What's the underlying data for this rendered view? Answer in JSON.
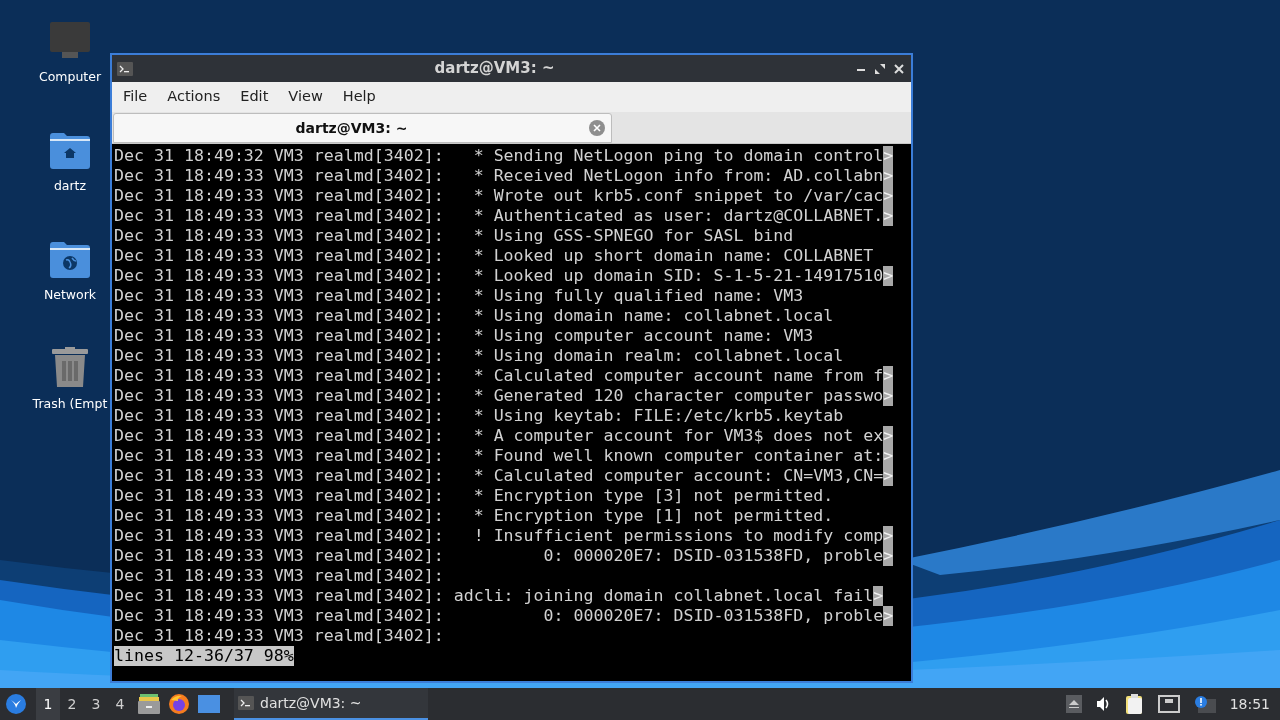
{
  "desktop_icons": [
    {
      "label": "Computer",
      "kind": "computer"
    },
    {
      "label": "dartz",
      "kind": "home"
    },
    {
      "label": "Network",
      "kind": "network"
    },
    {
      "label": "Trash (Empt",
      "kind": "trash"
    }
  ],
  "window": {
    "title": "dartz@VM3: ~",
    "menu": [
      "File",
      "Actions",
      "Edit",
      "View",
      "Help"
    ],
    "tabs": [
      {
        "label": "dartz@VM3: ~",
        "selected": true
      }
    ],
    "lines": [
      {
        "text": "Dec 31 18:49:32 VM3 realmd[3402]:   * Sending NetLogon ping to domain control",
        "more": ">"
      },
      {
        "text": "Dec 31 18:49:33 VM3 realmd[3402]:   * Received NetLogon info from: AD.collabn",
        "more": ">"
      },
      {
        "text": "Dec 31 18:49:33 VM3 realmd[3402]:   * Wrote out krb5.conf snippet to /var/cac",
        "more": ">"
      },
      {
        "text": "Dec 31 18:49:33 VM3 realmd[3402]:   * Authenticated as user: dartz@COLLABNET.",
        "more": ">"
      },
      {
        "text": "Dec 31 18:49:33 VM3 realmd[3402]:   * Using GSS-SPNEGO for SASL bind"
      },
      {
        "text": "Dec 31 18:49:33 VM3 realmd[3402]:   * Looked up short domain name: COLLABNET"
      },
      {
        "text": "Dec 31 18:49:33 VM3 realmd[3402]:   * Looked up domain SID: S-1-5-21-14917510",
        "more": ">"
      },
      {
        "text": "Dec 31 18:49:33 VM3 realmd[3402]:   * Using fully qualified name: VM3"
      },
      {
        "text": "Dec 31 18:49:33 VM3 realmd[3402]:   * Using domain name: collabnet.local"
      },
      {
        "text": "Dec 31 18:49:33 VM3 realmd[3402]:   * Using computer account name: VM3"
      },
      {
        "text": "Dec 31 18:49:33 VM3 realmd[3402]:   * Using domain realm: collabnet.local"
      },
      {
        "text": "Dec 31 18:49:33 VM3 realmd[3402]:   * Calculated computer account name from f",
        "more": ">"
      },
      {
        "text": "Dec 31 18:49:33 VM3 realmd[3402]:   * Generated 120 character computer passwo",
        "more": ">"
      },
      {
        "text": "Dec 31 18:49:33 VM3 realmd[3402]:   * Using keytab: FILE:/etc/krb5.keytab"
      },
      {
        "text": "Dec 31 18:49:33 VM3 realmd[3402]:   * A computer account for VM3$ does not ex",
        "more": ">"
      },
      {
        "text": "Dec 31 18:49:33 VM3 realmd[3402]:   * Found well known computer container at:",
        "more": ">"
      },
      {
        "text": "Dec 31 18:49:33 VM3 realmd[3402]:   * Calculated computer account: CN=VM3,CN=",
        "more": ">"
      },
      {
        "text": "Dec 31 18:49:33 VM3 realmd[3402]:   * Encryption type [3] not permitted."
      },
      {
        "text": "Dec 31 18:49:33 VM3 realmd[3402]:   * Encryption type [1] not permitted."
      },
      {
        "text": "Dec 31 18:49:33 VM3 realmd[3402]:   ! Insufficient permissions to modify comp",
        "more": ">"
      },
      {
        "text": "Dec 31 18:49:33 VM3 realmd[3402]:          0: 000020E7: DSID-031538FD, proble",
        "more": ">"
      },
      {
        "text": "Dec 31 18:49:33 VM3 realmd[3402]:"
      },
      {
        "text": "Dec 31 18:49:33 VM3 realmd[3402]: adcli: joining domain collabnet.local fail",
        "more": ">"
      },
      {
        "text": "Dec 31 18:49:33 VM3 realmd[3402]:          0: 000020E7: DSID-031538FD, proble",
        "more": ">"
      },
      {
        "text": "Dec 31 18:49:33 VM3 realmd[3402]:"
      }
    ],
    "pager_status": "lines 12-36/37 98%"
  },
  "taskbar": {
    "workspaces": [
      {
        "label": "1",
        "selected": true
      },
      {
        "label": "2",
        "selected": false
      },
      {
        "label": "3",
        "selected": false
      },
      {
        "label": "4",
        "selected": false
      }
    ],
    "tasks": [
      {
        "label": "dartz@VM3: ~",
        "selected": true
      }
    ],
    "clock": "18:51"
  }
}
